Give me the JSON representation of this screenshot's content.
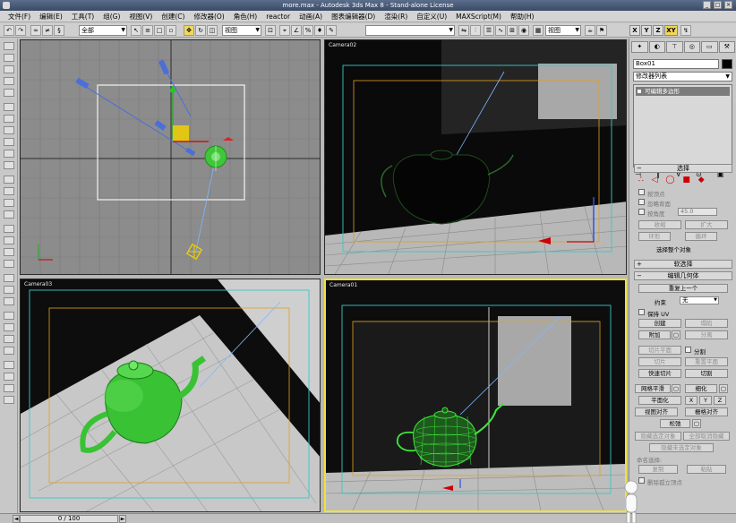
{
  "window": {
    "title": "more.max - Autodesk 3ds Max 8 - Stand-alone License",
    "controls": [
      "_",
      "□",
      "×"
    ]
  },
  "menu": {
    "items": [
      "文件(F)",
      "编辑(E)",
      "工具(T)",
      "组(G)",
      "视图(V)",
      "创建(C)",
      "修改器(O)",
      "角色(H)",
      "reactor",
      "动画(A)",
      "图表编辑器(D)",
      "渲染(R)",
      "自定义(U)",
      "MAXScript(M)",
      "帮助(H)"
    ]
  },
  "toolbar": {
    "selection_filter": "全部",
    "ref_coord": "视图",
    "named_selection": "",
    "axis_x": "X",
    "axis_y": "Y",
    "axis_z": "Z",
    "axis_xy": "XY"
  },
  "viewports": {
    "top_left": {
      "label": ""
    },
    "top_right": {
      "label": "Camera02"
    },
    "bottom_left": {
      "label": "Camera03"
    },
    "bottom_right": {
      "label": "Camera01"
    }
  },
  "panel": {
    "object_name": "Box01",
    "modifier_list": "修改器列表",
    "stack_item": "可编辑多边形",
    "stack_tools": [
      "⊣",
      "‖",
      "∀",
      "⊙",
      "▣"
    ],
    "selection": {
      "title": "选择",
      "by_vertex": "按顶点",
      "ignore_backfacing": "忽略背面",
      "by_angle": "按角度",
      "angle_value": "45.0",
      "shrink": "收缩",
      "grow": "扩大",
      "ring": "环形",
      "loop": "循环",
      "status": "选择整个对象"
    },
    "soft_selection": {
      "title": "软选择"
    },
    "edit_geometry": {
      "title": "编辑几何体",
      "repeat_last": "重复上一个",
      "constraints_label": "约束",
      "constraints_value": "无",
      "preserve_uvs": "保持 UV",
      "create": "创建",
      "collapse": "塌陷",
      "attach": "附加",
      "detach": "分离",
      "slice_plane": "切片平面",
      "split": "分割",
      "slice": "切片",
      "reset_plane": "重置平面",
      "quickslice": "快速切片",
      "cut": "切割",
      "msmooth": "网格平滑",
      "tessellate": "细化",
      "make_planar": "平面化",
      "x": "X",
      "y": "Y",
      "z": "Z",
      "view_align": "视图对齐",
      "grid_align": "栅格对齐",
      "relax": "松弛",
      "hide_selected": "隐藏选定对象",
      "unhide_all": "全部取消隐藏",
      "hide_unselected": "隐藏未选定对象",
      "named_selections": "命名选择:",
      "copy": "复制",
      "paste": "粘贴",
      "delete_isolated": "删除孤立顶点"
    }
  },
  "timeline": {
    "frame": "0 / 100"
  },
  "colors": {
    "viewport_gray": "#8c8c8c",
    "viewport_dark": "#101010",
    "teapot_green": "#3fc63a",
    "active_border": "#f0e23a",
    "camera_blue": "#3a5ec8"
  }
}
